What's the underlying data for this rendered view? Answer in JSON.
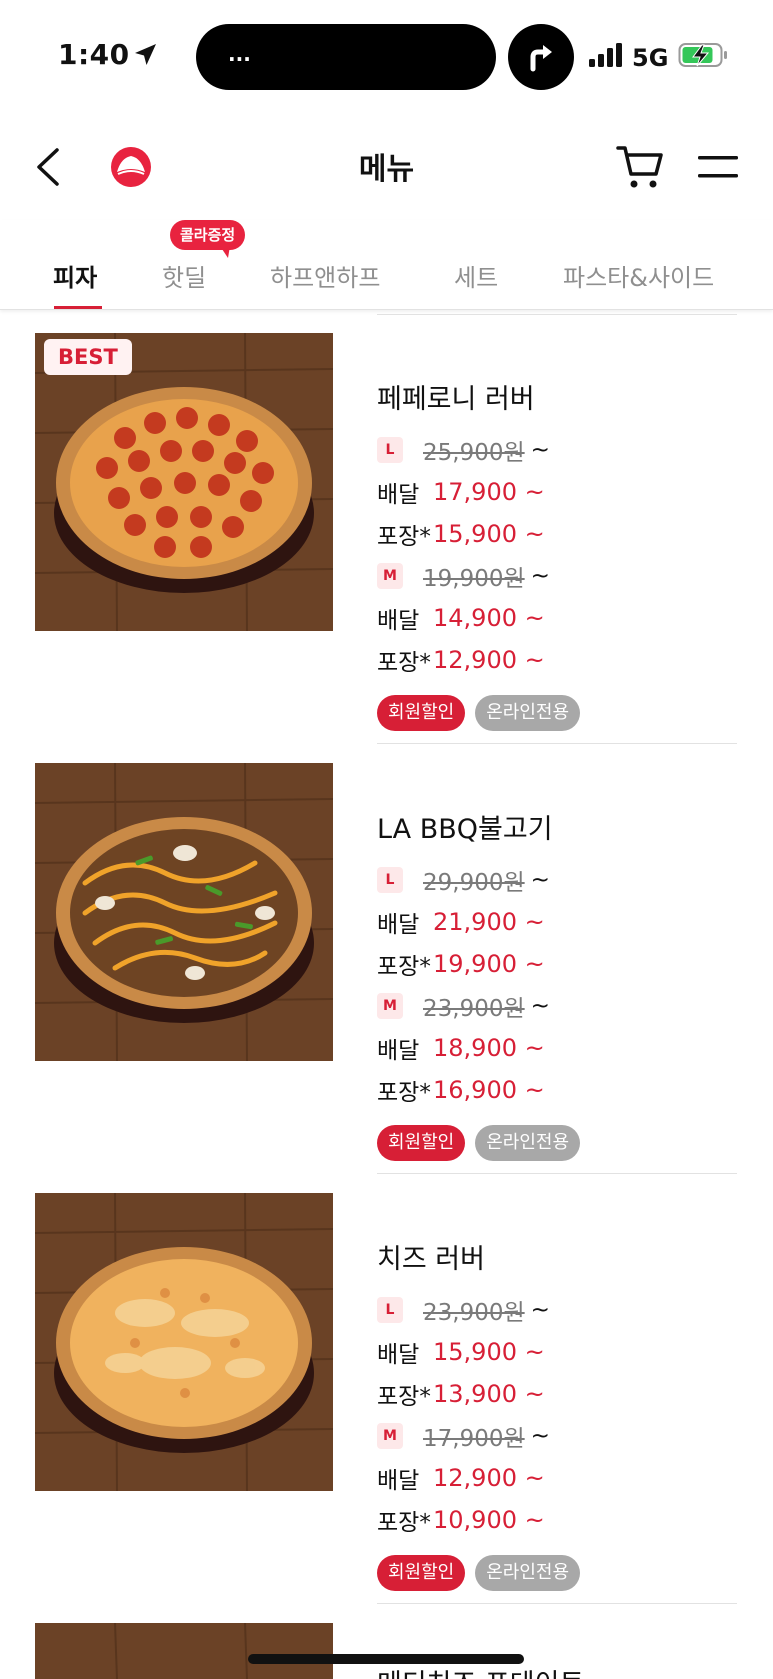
{
  "status_bar": {
    "time": "1:40",
    "island_text": "...",
    "network": "5G",
    "icons": [
      "location-arrow-icon",
      "turn-right-arrow-icon",
      "signal-icon",
      "battery-charging-icon"
    ]
  },
  "header": {
    "title": "메뉴",
    "icons": [
      "back-chevron-icon",
      "pizza-hut-logo-icon",
      "cart-icon",
      "hamburger-menu-icon"
    ]
  },
  "tabs": {
    "items": [
      {
        "label": "피자",
        "active": true
      },
      {
        "label": "핫딜",
        "active": false,
        "badge": "콜라증정"
      },
      {
        "label": "하프앤하프",
        "active": false
      },
      {
        "label": "세트",
        "active": false
      },
      {
        "label": "파스타&사이드",
        "active": false
      }
    ]
  },
  "colors": {
    "accent": "#d71f36",
    "badge_bg": "#e8233f",
    "tag_gray": "#a8a8a8",
    "chip_bg": "#fde8e9"
  },
  "products": [
    {
      "name": "페페로니 러버",
      "best_badge": "BEST",
      "image": "pepperoni-pizza",
      "large": {
        "size": "L",
        "original": "25,900원",
        "delivery_label": "배달",
        "delivery": "17,900 ~",
        "takeout_label": "포장*",
        "takeout": "15,900 ~"
      },
      "medium": {
        "size": "M",
        "original": "19,900원",
        "delivery_label": "배달",
        "delivery": "14,900 ~",
        "takeout_label": "포장*",
        "takeout": "12,900 ~"
      },
      "tags": [
        "회원할인",
        "온라인전용"
      ]
    },
    {
      "name": "LA BBQ불고기",
      "image": "bulgogi-pizza",
      "large": {
        "size": "L",
        "original": "29,900원",
        "delivery_label": "배달",
        "delivery": "21,900 ~",
        "takeout_label": "포장*",
        "takeout": "19,900 ~"
      },
      "medium": {
        "size": "M",
        "original": "23,900원",
        "delivery_label": "배달",
        "delivery": "18,900 ~",
        "takeout_label": "포장*",
        "takeout": "16,900 ~"
      },
      "tags": [
        "회원할인",
        "온라인전용"
      ]
    },
    {
      "name": "치즈 러버",
      "image": "cheese-pizza",
      "large": {
        "size": "L",
        "original": "23,900원",
        "delivery_label": "배달",
        "delivery": "15,900 ~",
        "takeout_label": "포장*",
        "takeout": "13,900 ~"
      },
      "medium": {
        "size": "M",
        "original": "17,900원",
        "delivery_label": "배달",
        "delivery": "12,900 ~",
        "takeout_label": "포장*",
        "takeout": "10,900 ~"
      },
      "tags": [
        "회원할인",
        "온라인전용"
      ]
    }
  ],
  "partial_product_name": "메디치즈 포테이토",
  "tilde": "~"
}
